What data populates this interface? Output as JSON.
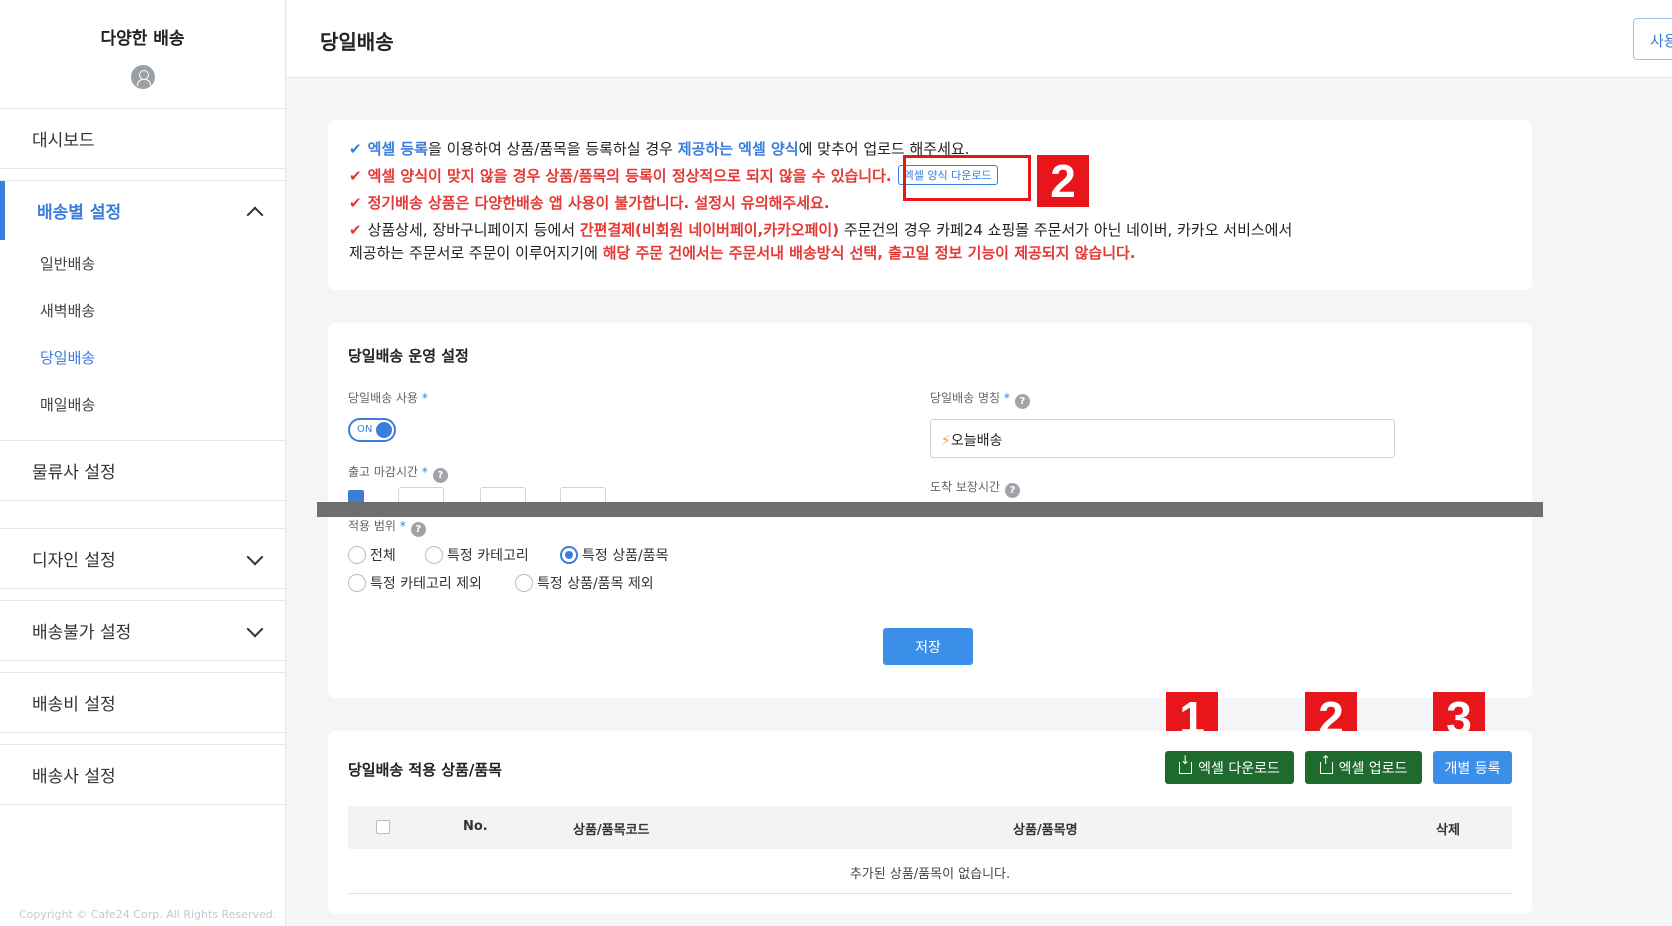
{
  "sidebar": {
    "brand": "다양한 배송",
    "items": [
      {
        "label": "대시보드"
      },
      {
        "label": "배송별 설정",
        "expanded": true,
        "sub": [
          "일반배송",
          "새벽배송",
          "당일배송",
          "매일배송"
        ]
      },
      {
        "label": "물류사 설정"
      },
      {
        "label": "디자인 설정"
      },
      {
        "label": "배송불가 설정"
      },
      {
        "label": "배송비 설정"
      },
      {
        "label": "배송사 설정"
      }
    ],
    "copyright": "Copyright © Cafe24 Corp. All Rights Reserved."
  },
  "header": {
    "title": "당일배송",
    "right_button": "사용"
  },
  "notice": {
    "line1": {
      "a": "엑셀 등록",
      "b": "을 이용하여 상품/품목을 등록하실 경우 ",
      "c": "제공하는 엑셀 양식",
      "d": "에 맞추어 업로드 해주세요."
    },
    "line2": "엑셀 양식이 맞지 않을 경우 상품/품목의 등록이 정상적으로 되지 않을 수 있습니다.",
    "template_button": "엑셀 양식 다운로드",
    "line3": "정기배송 상품은 다양한배송 앱 사용이 불가합니다. 설정시 유의해주세요.",
    "line4": {
      "a": "상품상세, 장바구니페이지 등에서 ",
      "b": "간편결제(비회원 네이버페이,카카오페이)",
      "c": " 주문건의 경우 카페24 쇼핑몰 주문서가 아닌 네이버, 카카오 서비스에서"
    },
    "line5": {
      "a": "제공하는 주문서로 주문이 이루어지기에 ",
      "b": "해당 주문 건에서는 주문서내 배송방식 선택, 출고일 정보 기능이 제공되지 않습니다."
    }
  },
  "settings": {
    "title": "당일배송 운영 설정",
    "use_label": "당일배송 사용",
    "toggle_text": "ON",
    "name_label": "당일배송 명칭",
    "name_value": "오늘배송",
    "name_icon": "⚡",
    "deadline_label": "출고 마감시간",
    "arrival_label": "도착 보장시간",
    "scope_label": "적용 범위",
    "scope_options": [
      "전체",
      "특정 카테고리",
      "특정 상품/품목",
      "특정 카테고리 제외",
      "특정 상품/품목 제외"
    ],
    "scope_selected": "특정 상품/품목",
    "save_button": "저장"
  },
  "products": {
    "title": "당일배송 적용 상품/품목",
    "btn_download": "엑셀 다운로드",
    "btn_upload": "엑셀 업로드",
    "btn_single": "개별 등록",
    "columns": [
      "No.",
      "상품/품목코드",
      "상품/품목명",
      "삭제"
    ],
    "empty_text": "추가된 상품/품목이 없습니다."
  },
  "annotations": [
    "2",
    "1",
    "2",
    "3"
  ],
  "colors": {
    "accent": "#3b7ddd",
    "danger": "#e53935",
    "green": "#1f6b2d",
    "annotation": "#e8151b"
  }
}
